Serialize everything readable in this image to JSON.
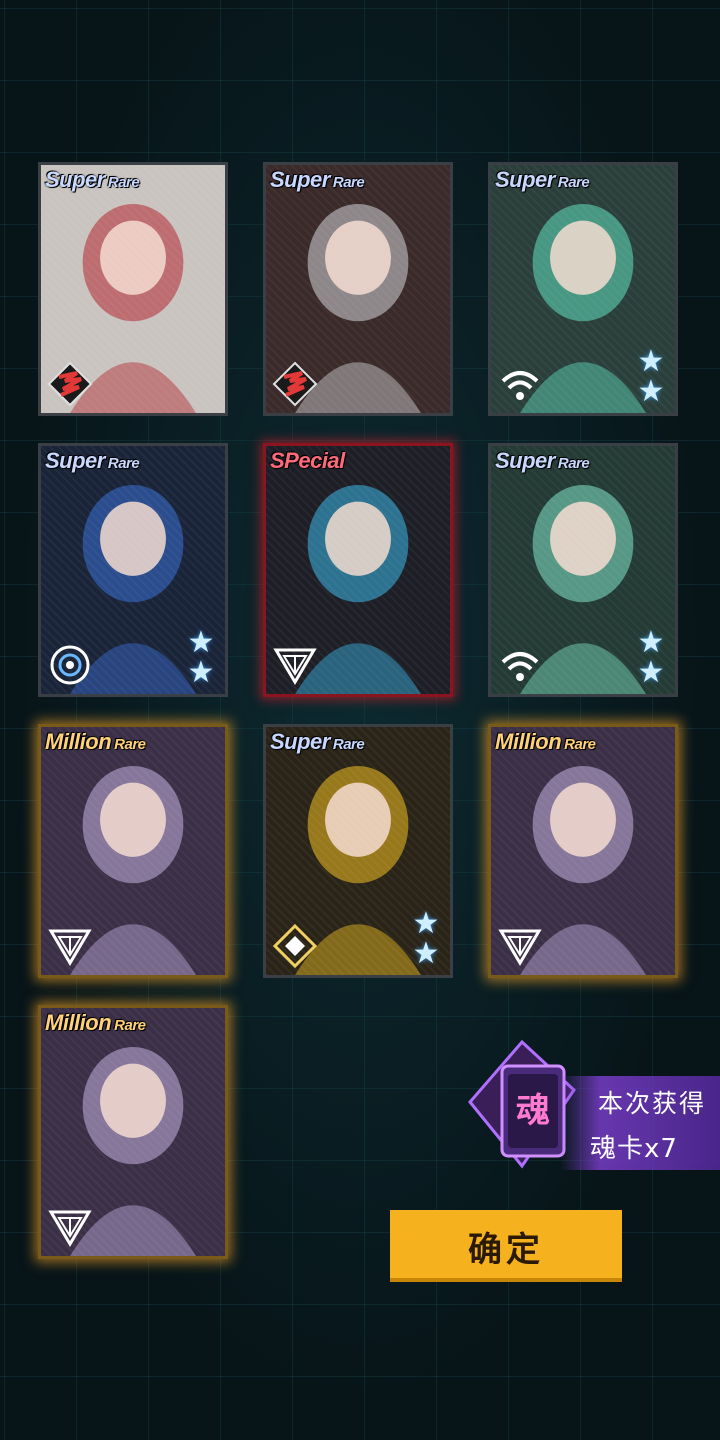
{
  "cards": [
    {
      "rarity_main": "Super",
      "rarity_sub": "Rare",
      "rarity_class": "sr",
      "faction_icon": "phoenix-crest-icon",
      "stars": 0,
      "theme": "#c9c4c0",
      "accent": "#b2262d"
    },
    {
      "rarity_main": "Super",
      "rarity_sub": "Rare",
      "rarity_class": "sr",
      "faction_icon": "phoenix-crest-icon",
      "stars": 0,
      "theme": "#3a2a2a",
      "accent": "#d4d4d8"
    },
    {
      "rarity_main": "Super",
      "rarity_sub": "Rare",
      "rarity_class": "sr",
      "faction_icon": "signal-icon",
      "stars": 2,
      "theme": "#2a3f3a",
      "accent": "#5fe0c0"
    },
    {
      "rarity_main": "Super",
      "rarity_sub": "Rare",
      "rarity_class": "sr",
      "faction_icon": "eye-crest-icon",
      "stars": 2,
      "theme": "#1a2438",
      "accent": "#3b6fd6"
    },
    {
      "rarity_main": "SPecial",
      "rarity_sub": "",
      "rarity_class": "sp",
      "faction_icon": "triangle-crest-icon",
      "stars": 0,
      "theme": "#1e1e26",
      "accent": "#3ab8e8"
    },
    {
      "rarity_main": "Super",
      "rarity_sub": "Rare",
      "rarity_class": "sr",
      "faction_icon": "signal-icon",
      "stars": 2,
      "theme": "#243a34",
      "accent": "#7fe6c8"
    },
    {
      "rarity_main": "Million",
      "rarity_sub": "Rare",
      "rarity_class": "mr",
      "faction_icon": "triangle-crest-icon",
      "stars": 0,
      "theme": "#3a2f46",
      "accent": "#c4b0e0"
    },
    {
      "rarity_main": "Super",
      "rarity_sub": "Rare",
      "rarity_class": "sr",
      "faction_icon": "diamond-crest-icon",
      "stars": 2,
      "theme": "#2a2418",
      "accent": "#f0c020"
    },
    {
      "rarity_main": "Million",
      "rarity_sub": "Rare",
      "rarity_class": "mr",
      "faction_icon": "triangle-crest-icon",
      "stars": 0,
      "theme": "#3a2f46",
      "accent": "#c4b0e0"
    },
    {
      "rarity_main": "Million",
      "rarity_sub": "Rare",
      "rarity_class": "mr",
      "faction_icon": "triangle-crest-icon",
      "stars": 0,
      "theme": "#3a2f46",
      "accent": "#c4b0e0"
    }
  ],
  "soul_reward": {
    "badge_char": "魂",
    "title": "本次获得",
    "count_text": "魂卡x7"
  },
  "confirm_label": "确定",
  "colors": {
    "confirm_bg": "#f5b21e",
    "special_glow": "#dc1e28",
    "million_glow": "#ffaa28",
    "soul_purple": "#7a3cc8"
  }
}
